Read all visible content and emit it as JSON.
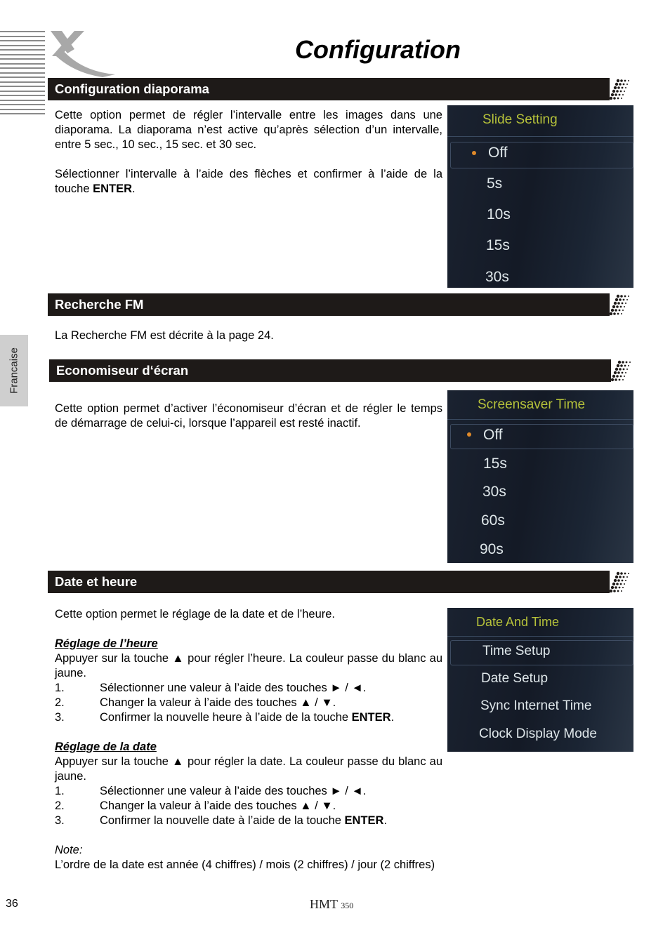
{
  "header": {
    "title": "Configuration",
    "logo": "x-brand-logo"
  },
  "side_tab": {
    "label": "Francaise"
  },
  "sections": [
    {
      "heading": "Configuration diaporama",
      "paragraphs": [
        "Cette option permet de régler l’intervalle entre les images dans une diaporama. La diaporama n’est active qu’après sélection d’un intervalle, entre 5 sec., 10 sec., 15 sec. et 30 sec.",
        "Sélectionner l’intervalle à l’aide des flèches et confirmer à l’aide de la touche "
      ],
      "enter_key": "ENTER",
      "screen": {
        "title": "Slide Setting",
        "items": [
          "Off",
          "5s",
          "10s",
          "15s",
          "30s"
        ],
        "selected": "Off"
      }
    },
    {
      "heading": "Recherche FM",
      "paragraphs": [
        "La Recherche FM est décrite à la page 24."
      ]
    },
    {
      "heading": "Economiseur d‘écran",
      "paragraphs": [
        "Cette option permet d’activer l’économiseur d’écran et de régler le temps de démarrage de celui-ci, lorsque l’appareil est resté inactif."
      ],
      "screen": {
        "title": "Screensaver Time",
        "items": [
          "Off",
          "15s",
          "30s",
          "60s",
          "90s"
        ],
        "selected": "Off"
      }
    },
    {
      "heading": "Date et heure",
      "intro": "Cette option permet le réglage de la date et de l’heure.",
      "time": {
        "subheading": "Réglage de l’heure",
        "text": "Appuyer sur la touche ▲ pour régler l’heure. La couleur passe du blanc au jaune.",
        "steps": [
          {
            "n": "1.",
            "text": "Sélectionner une valeur à l’aide des touches ► / ◄."
          },
          {
            "n": "2.",
            "text": "Changer la valeur à l’aide des touches ▲ / ▼."
          },
          {
            "n": "3.",
            "text": "Confirmer la nouvelle heure à l’aide de la touche ",
            "bold": "ENTER",
            "end": "."
          }
        ]
      },
      "date": {
        "subheading": "Réglage de la date",
        "text": "Appuyer sur la touche ▲ pour régler la date. La couleur passe du blanc au jaune.",
        "steps": [
          {
            "n": "1.",
            "text": "Sélectionner une valeur à l’aide des touches ► / ◄."
          },
          {
            "n": "2.",
            "text": "Changer la valeur à l’aide des touches ▲ / ▼."
          },
          {
            "n": "3.",
            "text": "Confirmer la nouvelle date à l’aide de la touche ",
            "bold": "ENTER",
            "end": "."
          }
        ]
      },
      "note_label": "Note:",
      "note_text": "L’ordre de la date est année (4 chiffres) / mois (2 chiffres) / jour (2 chiffres)",
      "screen": {
        "title": "Date And Time",
        "items": [
          "Time Setup",
          "Date Setup",
          "Sync Internet Time",
          "Clock Display Mode"
        ],
        "selected": "Time Setup"
      }
    }
  ],
  "footer": {
    "page_number": "36",
    "model_name": "HMT",
    "model_number": "350"
  },
  "colors": {
    "section_bar": "#1e1a18",
    "osd_title": "#b6c23a",
    "osd_bullet": "#e08a2a"
  }
}
